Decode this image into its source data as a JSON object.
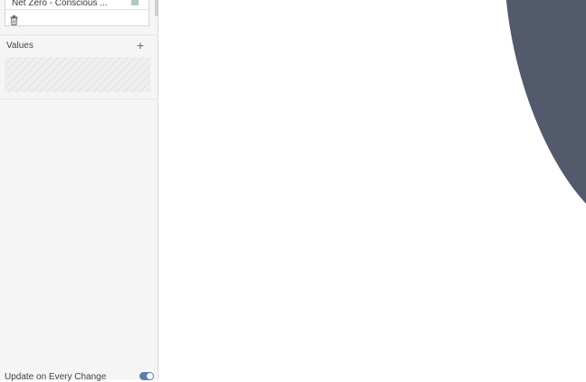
{
  "sidebar": {
    "field_item": {
      "label": "Net Zero - Conscious ..."
    },
    "values_section": {
      "title": "Values",
      "add_icon": "plus-icon"
    },
    "trash_icon": "trash-icon",
    "update_on_change": {
      "label": "Update on Every Change",
      "enabled": true
    }
  },
  "colors": {
    "pie_slice": "#535a6b",
    "toggle_on": "#5b7bb0",
    "swatch": "#b3c7c4"
  }
}
